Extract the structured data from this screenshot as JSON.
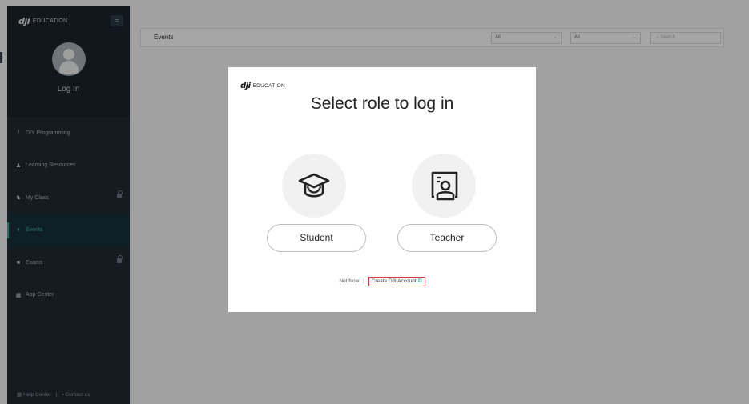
{
  "sidebar": {
    "logo_mark": "dji",
    "logo_text": "EDUCATION",
    "menu_icon": "≡",
    "login_label": "Log In",
    "items": [
      {
        "icon": "/",
        "icon_name": "pencil-icon",
        "label": "DIY Programming",
        "locked": false,
        "active": false
      },
      {
        "icon": "♟",
        "icon_name": "person-icon",
        "label": "Learning Resources",
        "locked": false,
        "active": false
      },
      {
        "icon": "♞",
        "icon_name": "group-icon",
        "label": "My Class",
        "locked": true,
        "active": false
      },
      {
        "icon": "♦",
        "icon_name": "trophy-icon",
        "label": "Events",
        "locked": false,
        "active": true
      },
      {
        "icon": "■",
        "icon_name": "book-icon",
        "label": "Exams",
        "locked": true,
        "active": false
      },
      {
        "icon": "▦",
        "icon_name": "grid-icon",
        "label": "App Center",
        "locked": false,
        "active": false
      }
    ],
    "footer": {
      "help": "Help Center",
      "divider": "|",
      "contact": "Contact us"
    }
  },
  "topbar": {
    "title": "Events",
    "filter1": "All",
    "filter2": "All",
    "search_placeholder": "Search"
  },
  "modal": {
    "logo_mark": "dji",
    "logo_text": "EDUCATION",
    "title": "Select role to log in",
    "student_label": "Student",
    "teacher_label": "Teacher",
    "not_now": "Not Now",
    "separator": "|",
    "create_account": "Create DJI Account",
    "external_icon": "⧉"
  },
  "colors": {
    "accent": "#2bb3a3",
    "highlight": "#e53935",
    "sidebar_bg": "#1f2a33"
  }
}
